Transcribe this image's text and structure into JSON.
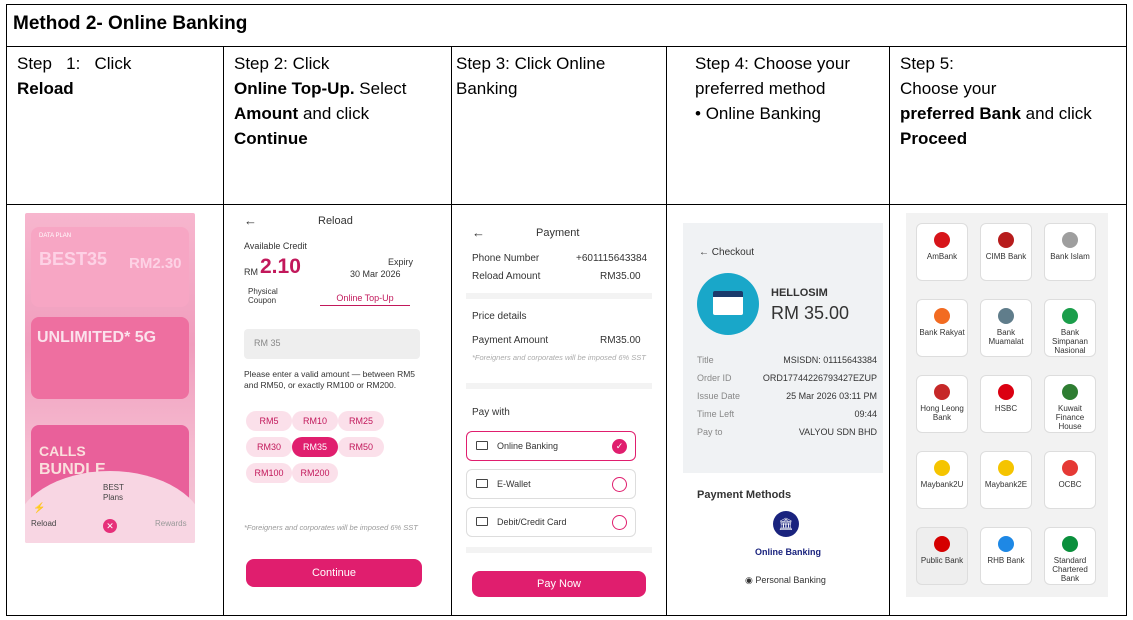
{
  "title": "Method 2- Online Banking",
  "steps": {
    "s1": {
      "prefix": "Step   1:   Click",
      "bold": "Reload"
    },
    "s2": {
      "l1": "Step 2: Click",
      "b1": "Online Top-Up.",
      "t1": " Select",
      "b2": "Amount",
      "t2": " and click",
      "b3": "Continue"
    },
    "s3": {
      "l1": "Step 3: Click Online",
      "l2": "Banking"
    },
    "s4": {
      "l1": "Step 4: Choose your",
      "l2": "preferred method",
      "bullet": "Online Banking"
    },
    "s5": {
      "l1": "Step 5:",
      "l2": "Choose your",
      "b1": "preferred Bank",
      "t1": " and click",
      "b2": "Proceed"
    }
  },
  "shot1": {
    "plan": "DATA PLAN",
    "best": "BEST35",
    "price": "RM2.30",
    "unl": "UNLIMITED* 5G",
    "bundle": "BUNDLE",
    "calls": "CALLS",
    "best_plans_1": "BEST",
    "best_plans_2": "Plans",
    "reload": "Reload",
    "rewards": "Rewards"
  },
  "shot2": {
    "header": "Reload",
    "avail": "Available Credit",
    "rm": "RM",
    "credit": "2.10",
    "expiry_label": "Expiry",
    "expiry": "30 Mar 2026",
    "tab1a": "Physical",
    "tab1b": "Coupon",
    "tab2": "Online Top-Up",
    "input": "RM 35",
    "hint": "Please enter a valid amount — between RM5 and RM50, or exactly RM100 or RM200.",
    "chips": [
      "RM5",
      "RM10",
      "RM25",
      "RM30",
      "RM35",
      "RM50",
      "RM100",
      "RM200"
    ],
    "note": "*Foreigners and corporates will be imposed 6% SST",
    "continue": "Continue"
  },
  "shot3": {
    "header": "Payment",
    "phone_label": "Phone Number",
    "phone": "+601115643384",
    "reload_label": "Reload Amount",
    "reload": "RM35.00",
    "price_details": "Price details",
    "pay_amount_label": "Payment Amount",
    "pay_amount": "RM35.00",
    "note": "*Foreigners and corporates will be imposed 6% SST",
    "pay_with": "Pay with",
    "options": [
      "Online Banking",
      "E-Wallet",
      "Debit/Credit Card"
    ],
    "paynow": "Pay Now"
  },
  "shot4": {
    "checkout": "Checkout",
    "merchant": "HELLOSIM",
    "amount": "RM 35.00",
    "rows": [
      {
        "k": "Title",
        "v": "MSISDN: 01115643384"
      },
      {
        "k": "Order ID",
        "v": "ORD17744226793427EZUP"
      },
      {
        "k": "Issue Date",
        "v": "25 Mar 2026 03:11 PM"
      },
      {
        "k": "Time Left",
        "v": "09:44"
      },
      {
        "k": "Pay to",
        "v": "VALYOU SDN BHD"
      }
    ],
    "methods": "Payment Methods",
    "online": "Online Banking",
    "personal": "Personal Banking"
  },
  "shot5": {
    "banks": [
      {
        "name": "AmBank",
        "color": "#d7141a"
      },
      {
        "name": "CIMB Bank",
        "color": "#b71c1c"
      },
      {
        "name": "Bank Islam",
        "color": "#9e9e9e"
      },
      {
        "name": "Bank Rakyat",
        "color": "#f26b21"
      },
      {
        "name": "Bank Muamalat",
        "color": "#607d8b"
      },
      {
        "name": "Bank Simpanan Nasional",
        "color": "#1b9e4b"
      },
      {
        "name": "Hong Leong Bank",
        "color": "#c62828"
      },
      {
        "name": "HSBC",
        "color": "#db0011"
      },
      {
        "name": "Kuwait Finance House",
        "color": "#2e7d32"
      },
      {
        "name": "Maybank2U",
        "color": "#f5c400"
      },
      {
        "name": "Maybank2E",
        "color": "#f5c400"
      },
      {
        "name": "OCBC",
        "color": "#e53935"
      },
      {
        "name": "Public Bank",
        "color": "#d50000"
      },
      {
        "name": "RHB Bank",
        "color": "#1e88e5"
      },
      {
        "name": "Standard Chartered Bank",
        "color": "#0a8f3c"
      }
    ]
  }
}
